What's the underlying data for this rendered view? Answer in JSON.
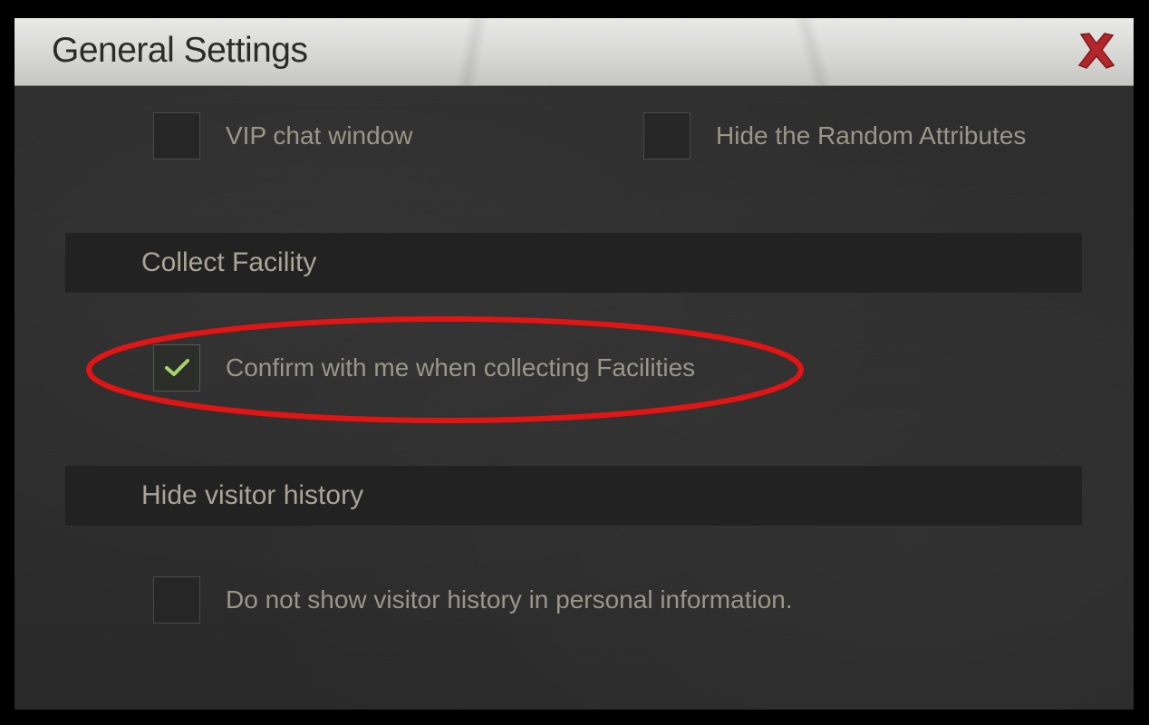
{
  "window": {
    "title": "General Settings"
  },
  "options_top": [
    {
      "label": "VIP chat window",
      "checked": false
    },
    {
      "label": "Hide the Random Attributes",
      "checked": false
    }
  ],
  "sections": [
    {
      "title": "Collect Facility",
      "options": [
        {
          "label": "Confirm with me when collecting Facilities",
          "checked": true
        }
      ]
    },
    {
      "title": "Hide visitor history",
      "options": [
        {
          "label": "Do not show visitor history in personal information.",
          "checked": false
        }
      ]
    }
  ],
  "icons": {
    "close": "close-x-icon",
    "check": "checkmark-icon"
  },
  "colors": {
    "close_red": "#b3262a",
    "check_green": "#a8d36a",
    "annotation_red": "#e21414"
  }
}
